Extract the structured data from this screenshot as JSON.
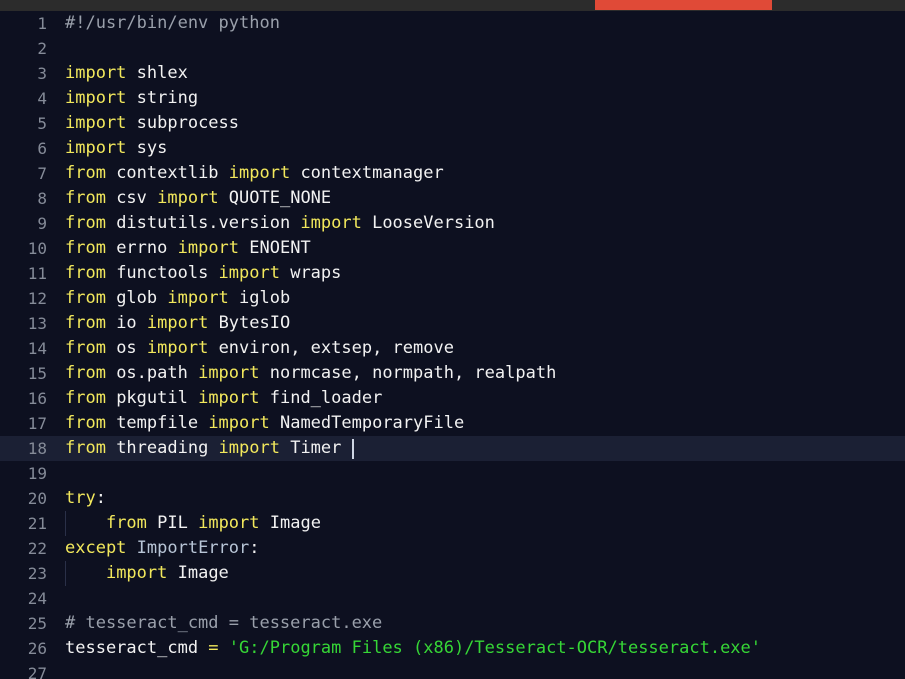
{
  "window": {
    "top_bar": {
      "accent_color": "#e04a37",
      "bar_color": "#2c2c2c"
    }
  },
  "editor": {
    "language": "python",
    "background_color": "#0d1020",
    "active_line_number": 18,
    "active_line_color": "#1b2034",
    "gutter_color": "#858b98",
    "caret": {
      "line": 18,
      "column": 26
    },
    "font_size_px": 17,
    "line_height_px": 25,
    "colors": {
      "keyword": "#f2e85c",
      "plain": "#f2f2f2",
      "comment": "#9aa0ab",
      "builtin": "#b8c5d6",
      "string": "#36d636",
      "operator": "#f2e85c"
    },
    "lines": [
      {
        "n": "1",
        "indent": 0,
        "tokens": [
          {
            "t": "#!/usr/bin/env python",
            "c": "t-comment"
          }
        ]
      },
      {
        "n": "2",
        "indent": 0,
        "tokens": []
      },
      {
        "n": "3",
        "indent": 0,
        "tokens": [
          {
            "t": "import",
            "c": "t-kw"
          },
          {
            "t": " shlex",
            "c": "t-plain"
          }
        ]
      },
      {
        "n": "4",
        "indent": 0,
        "tokens": [
          {
            "t": "import",
            "c": "t-kw"
          },
          {
            "t": " string",
            "c": "t-plain"
          }
        ]
      },
      {
        "n": "5",
        "indent": 0,
        "tokens": [
          {
            "t": "import",
            "c": "t-kw"
          },
          {
            "t": " subprocess",
            "c": "t-plain"
          }
        ]
      },
      {
        "n": "6",
        "indent": 0,
        "tokens": [
          {
            "t": "import",
            "c": "t-kw"
          },
          {
            "t": " sys",
            "c": "t-plain"
          }
        ]
      },
      {
        "n": "7",
        "indent": 0,
        "tokens": [
          {
            "t": "from",
            "c": "t-kw"
          },
          {
            "t": " contextlib ",
            "c": "t-plain"
          },
          {
            "t": "import",
            "c": "t-kw"
          },
          {
            "t": " contextmanager",
            "c": "t-plain"
          }
        ]
      },
      {
        "n": "8",
        "indent": 0,
        "tokens": [
          {
            "t": "from",
            "c": "t-kw"
          },
          {
            "t": " csv ",
            "c": "t-plain"
          },
          {
            "t": "import",
            "c": "t-kw"
          },
          {
            "t": " QUOTE_NONE",
            "c": "t-plain"
          }
        ]
      },
      {
        "n": "9",
        "indent": 0,
        "tokens": [
          {
            "t": "from",
            "c": "t-kw"
          },
          {
            "t": " distutils.version ",
            "c": "t-plain"
          },
          {
            "t": "import",
            "c": "t-kw"
          },
          {
            "t": " LooseVersion",
            "c": "t-plain"
          }
        ]
      },
      {
        "n": "10",
        "indent": 0,
        "tokens": [
          {
            "t": "from",
            "c": "t-kw"
          },
          {
            "t": " errno ",
            "c": "t-plain"
          },
          {
            "t": "import",
            "c": "t-kw"
          },
          {
            "t": " ENOENT",
            "c": "t-plain"
          }
        ]
      },
      {
        "n": "11",
        "indent": 0,
        "tokens": [
          {
            "t": "from",
            "c": "t-kw"
          },
          {
            "t": " functools ",
            "c": "t-plain"
          },
          {
            "t": "import",
            "c": "t-kw"
          },
          {
            "t": " wraps",
            "c": "t-plain"
          }
        ]
      },
      {
        "n": "12",
        "indent": 0,
        "tokens": [
          {
            "t": "from",
            "c": "t-kw"
          },
          {
            "t": " glob ",
            "c": "t-plain"
          },
          {
            "t": "import",
            "c": "t-kw"
          },
          {
            "t": " iglob",
            "c": "t-plain"
          }
        ]
      },
      {
        "n": "13",
        "indent": 0,
        "tokens": [
          {
            "t": "from",
            "c": "t-kw"
          },
          {
            "t": " io ",
            "c": "t-plain"
          },
          {
            "t": "import",
            "c": "t-kw"
          },
          {
            "t": " BytesIO",
            "c": "t-plain"
          }
        ]
      },
      {
        "n": "14",
        "indent": 0,
        "tokens": [
          {
            "t": "from",
            "c": "t-kw"
          },
          {
            "t": " os ",
            "c": "t-plain"
          },
          {
            "t": "import",
            "c": "t-kw"
          },
          {
            "t": " environ, extsep, remove",
            "c": "t-plain"
          }
        ]
      },
      {
        "n": "15",
        "indent": 0,
        "tokens": [
          {
            "t": "from",
            "c": "t-kw"
          },
          {
            "t": " os.path ",
            "c": "t-plain"
          },
          {
            "t": "import",
            "c": "t-kw"
          },
          {
            "t": " normcase, normpath, realpath",
            "c": "t-plain"
          }
        ]
      },
      {
        "n": "16",
        "indent": 0,
        "tokens": [
          {
            "t": "from",
            "c": "t-kw"
          },
          {
            "t": " pkgutil ",
            "c": "t-plain"
          },
          {
            "t": "import",
            "c": "t-kw"
          },
          {
            "t": " find_loader",
            "c": "t-plain"
          }
        ]
      },
      {
        "n": "17",
        "indent": 0,
        "tokens": [
          {
            "t": "from",
            "c": "t-kw"
          },
          {
            "t": " tempfile ",
            "c": "t-plain"
          },
          {
            "t": "import",
            "c": "t-kw"
          },
          {
            "t": " NamedTemporaryFile",
            "c": "t-plain"
          }
        ]
      },
      {
        "n": "18",
        "indent": 0,
        "active": true,
        "tokens": [
          {
            "t": "from",
            "c": "t-kw"
          },
          {
            "t": " threading ",
            "c": "t-plain"
          },
          {
            "t": "import",
            "c": "t-kw"
          },
          {
            "t": " Timer",
            "c": "t-plain"
          }
        ]
      },
      {
        "n": "19",
        "indent": 0,
        "tokens": []
      },
      {
        "n": "20",
        "indent": 0,
        "tokens": [
          {
            "t": "try",
            "c": "t-kw"
          },
          {
            "t": ":",
            "c": "t-plain"
          }
        ]
      },
      {
        "n": "21",
        "indent": 1,
        "tokens": [
          {
            "t": "    ",
            "c": "t-plain"
          },
          {
            "t": "from",
            "c": "t-kw"
          },
          {
            "t": " PIL ",
            "c": "t-plain"
          },
          {
            "t": "import",
            "c": "t-kw"
          },
          {
            "t": " Image",
            "c": "t-plain"
          }
        ]
      },
      {
        "n": "22",
        "indent": 0,
        "tokens": [
          {
            "t": "except",
            "c": "t-kw"
          },
          {
            "t": " ",
            "c": "t-plain"
          },
          {
            "t": "ImportError",
            "c": "t-builtin"
          },
          {
            "t": ":",
            "c": "t-plain"
          }
        ]
      },
      {
        "n": "23",
        "indent": 1,
        "tokens": [
          {
            "t": "    ",
            "c": "t-plain"
          },
          {
            "t": "import",
            "c": "t-kw"
          },
          {
            "t": " Image",
            "c": "t-plain"
          }
        ]
      },
      {
        "n": "24",
        "indent": 0,
        "tokens": []
      },
      {
        "n": "25",
        "indent": 0,
        "tokens": [
          {
            "t": "# tesseract_cmd = tesseract.exe",
            "c": "t-comment"
          }
        ]
      },
      {
        "n": "26",
        "indent": 0,
        "tokens": [
          {
            "t": "tesseract_cmd ",
            "c": "t-plain"
          },
          {
            "t": "=",
            "c": "t-op"
          },
          {
            "t": " ",
            "c": "t-plain"
          },
          {
            "t": "'G:/Program Files (x86)/Tesseract-OCR/tesseract.exe'",
            "c": "t-string"
          }
        ]
      },
      {
        "n": "27",
        "indent": 0,
        "tokens": []
      }
    ]
  }
}
